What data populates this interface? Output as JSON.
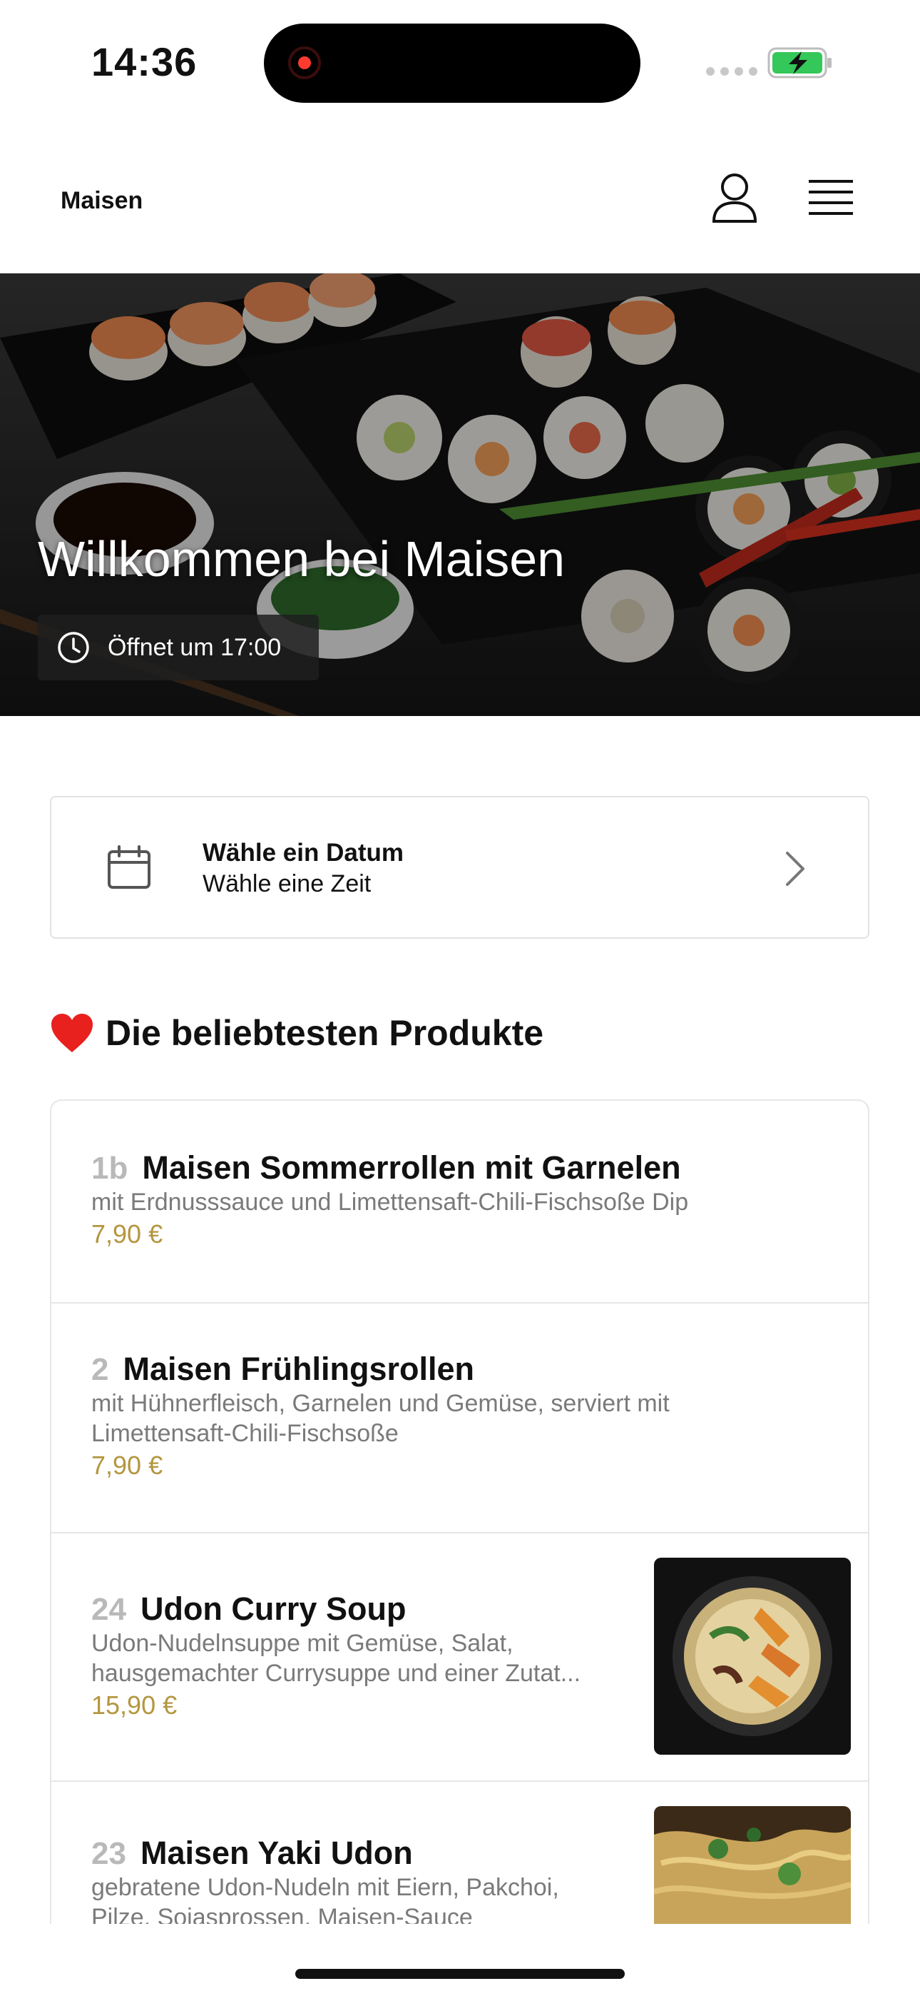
{
  "status_bar": {
    "time": "14:36"
  },
  "nav": {
    "brand": "Maisen"
  },
  "hero": {
    "title": "Willkommen bei Maisen",
    "open_text": "Öffnet um 17:00"
  },
  "date_picker": {
    "title": "Wähle ein Datum",
    "subtitle": "Wähle eine Zeit"
  },
  "section": {
    "title": "Die beliebtesten Produkte"
  },
  "products": [
    {
      "number": "1b",
      "name": "Maisen Sommerrollen mit Garnelen",
      "desc1": "mit Erdnusssauce und Limettensaft-Chili-Fischsoße Dip",
      "desc2": "",
      "price": "7,90 €"
    },
    {
      "number": "2",
      "name": "Maisen Frühlingsrollen",
      "desc1": "mit Hühnerfleisch, Garnelen und Gemüse, serviert mit",
      "desc2": "Limettensaft-Chili-Fischsoße",
      "price": "7,90 €"
    },
    {
      "number": "24",
      "name": "Udon Curry Soup",
      "desc1": "Udon-Nudelnsuppe mit Gemüse, Salat,",
      "desc2": "hausgemachter Currysuppe und einer Zutat...",
      "price": "15,90 €"
    },
    {
      "number": "23",
      "name": "Maisen Yaki Udon",
      "desc1": "gebratene Udon-Nudeln mit Eiern, Pakchoi,",
      "desc2": "Pilze, Sojasprossen, Maisen-Sauce",
      "price": ""
    }
  ],
  "colors": {
    "price": "#b4963f",
    "number": "#b9b9b9",
    "border": "#e6e6e6",
    "recording": "#ff3b30",
    "battery": "#34c759"
  },
  "icons": [
    "record-icon",
    "signal-icon",
    "battery-charging-icon",
    "user-icon",
    "menu-icon",
    "clock-icon",
    "calendar-icon",
    "chevron-right-icon",
    "heart-icon"
  ]
}
